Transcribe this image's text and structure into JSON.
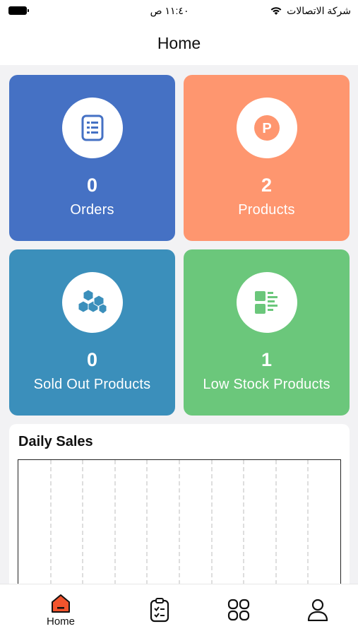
{
  "status_bar": {
    "carrier": "شركة الاتصالات",
    "time": "١١:٤٠ ص"
  },
  "header": {
    "title": "Home"
  },
  "cards": [
    {
      "count": "0",
      "label": "Orders",
      "color": "#4571c4",
      "icon": "orders-list-icon"
    },
    {
      "count": "2",
      "label": "Products",
      "color": "#fe966f",
      "icon": "product-p-icon"
    },
    {
      "count": "0",
      "label": "Sold Out Products",
      "color": "#3b8fbb",
      "icon": "boxes-icon"
    },
    {
      "count": "1",
      "label": "Low Stock Products",
      "color": "#6bc77b",
      "icon": "stock-list-icon"
    }
  ],
  "daily_sales": {
    "title": "Daily Sales"
  },
  "tabbar": {
    "items": [
      {
        "label": "Home",
        "icon": "home-icon",
        "active": true
      },
      {
        "label": "",
        "icon": "clipboard-icon",
        "active": false
      },
      {
        "label": "",
        "icon": "grid-icon",
        "active": false
      },
      {
        "label": "",
        "icon": "profile-icon",
        "active": false
      }
    ],
    "accent": "#f2542d"
  }
}
